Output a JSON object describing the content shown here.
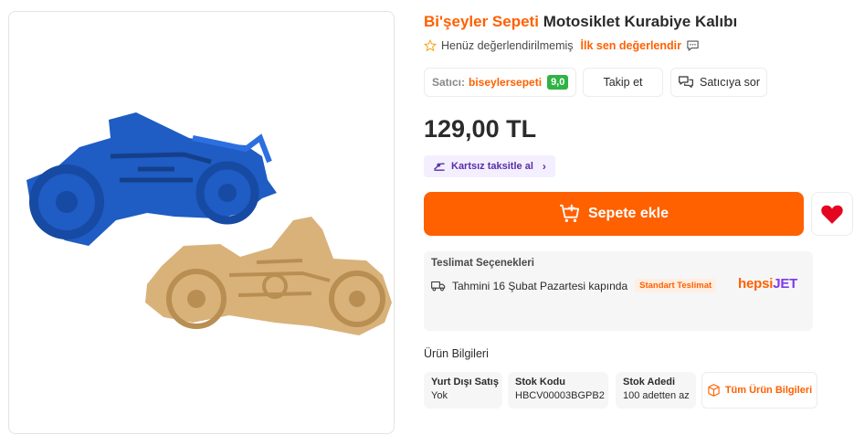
{
  "product": {
    "brand": "Bi'şeyler Sepeti",
    "name": "Motosiklet Kurabiye Kalıbı",
    "image_alt": "Motosiklet kurabiye kalıbı ve kurabiye"
  },
  "rating": {
    "status": "Henüz değerlendirilmemiş",
    "action": "İlk sen değerlendir"
  },
  "seller": {
    "label": "Satıcı:",
    "name": "biseylersepeti",
    "score": "9,0",
    "follow_label": "Takip et",
    "ask_label": "Satıcıya sor"
  },
  "price": "129,00 TL",
  "installment": {
    "label": "Kartsız taksitle al"
  },
  "cart": {
    "label": "Sepete ekle"
  },
  "delivery": {
    "title": "Teslimat Seçenekleri",
    "estimate": "Tahmini 16 Şubat Pazartesi kapında",
    "badge": "Standart Teslimat",
    "carrier_a": "hepsi",
    "carrier_b": "JET"
  },
  "info": {
    "title": "Ürün Bilgileri",
    "specs": [
      {
        "key": "Yurt Dışı Satış",
        "value": "Yok"
      },
      {
        "key": "Stok Kodu",
        "value": "HBCV00003BGPB2"
      },
      {
        "key": "Stok Adedi",
        "value": "100 adetten az"
      }
    ],
    "all_label": "Tüm Ürün Bilgileri"
  },
  "colors": {
    "accent": "#ff6000",
    "score": "#2fb344",
    "installment": "#5a2da8",
    "favorite": "#e4051f",
    "mold": "#1f5cc4",
    "cookie": "#d9b27a"
  },
  "icons": [
    "star-icon",
    "comment-icon",
    "chat-icon",
    "installment-icon",
    "chevron-right-icon",
    "cart-plus-icon",
    "heart-icon",
    "truck-icon",
    "box-icon"
  ]
}
